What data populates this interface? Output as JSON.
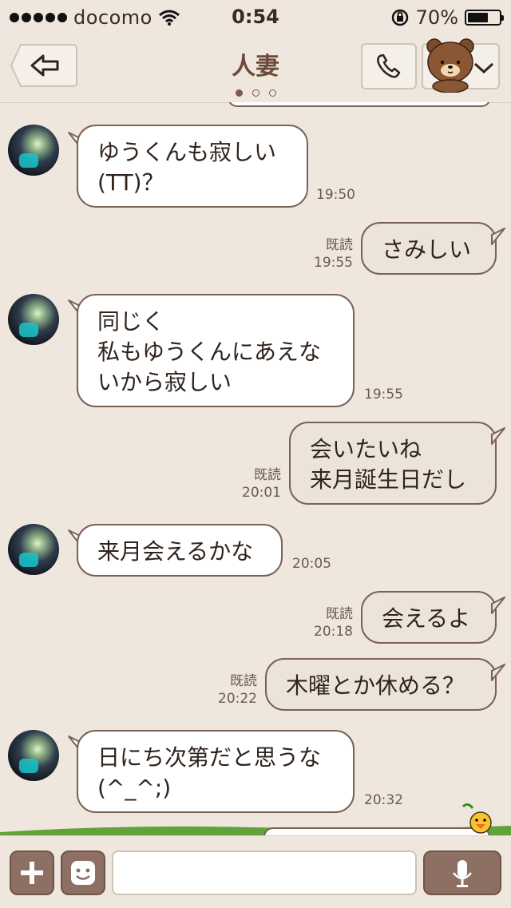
{
  "status": {
    "carrier": "docomo",
    "time": "0:54",
    "battery": "70%",
    "battery_level": 0.7
  },
  "header": {
    "title": "人妻",
    "page_dots": 3,
    "active_dot": 0
  },
  "messages": [
    {
      "dir": "in",
      "text": "ゆうくんも寂しい\n(TT)？",
      "time": "19:50"
    },
    {
      "dir": "out",
      "text": "さみしい",
      "read": "既読",
      "time": "19:55"
    },
    {
      "dir": "in",
      "text": "同じく\n私もゆうくんにあえな\nいから寂しい",
      "time": "19:55"
    },
    {
      "dir": "out",
      "text": "会いたいね\n来月誕生日だし",
      "read": "既読",
      "time": "20:01"
    },
    {
      "dir": "in",
      "text": "来月会えるかな",
      "time": "20:05"
    },
    {
      "dir": "out",
      "text": "会えるよ",
      "read": "既読",
      "time": "20:18"
    },
    {
      "dir": "out",
      "text": "木曜とか休める？",
      "read": "既読",
      "time": "20:22"
    },
    {
      "dir": "in",
      "text": "日にち次第だと思うな\n(^_^;)",
      "time": "20:32"
    }
  ],
  "input": {
    "placeholder": ""
  },
  "icons": {
    "back": "back-arrow-icon",
    "call": "phone-icon",
    "menu": "chevron-down-icon",
    "add": "plus-icon",
    "sticker": "emoji-face-icon",
    "mic": "microphone-icon"
  },
  "colors": {
    "background": "#efe7dd",
    "bubble_border": "#7b6055",
    "incoming_bubble": "#ffffff",
    "outgoing_bubble": "#ece4d9",
    "button_brown": "#8d7063"
  }
}
